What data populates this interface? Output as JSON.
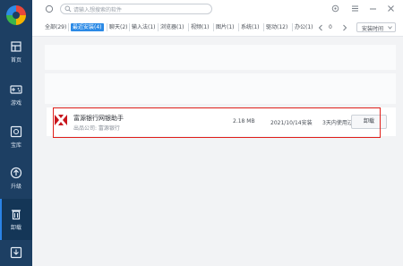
{
  "colors": {
    "sidebar_bg": "#1d3f63",
    "accent": "#2b8ae6",
    "highlight_border": "#e0201b"
  },
  "sidebar": {
    "items": [
      {
        "label": "首页",
        "icon": "home-icon"
      },
      {
        "label": "游戏",
        "icon": "gamepad-icon"
      },
      {
        "label": "宝库",
        "icon": "treasury-icon"
      },
      {
        "label": "升级",
        "icon": "upgrade-icon"
      },
      {
        "label": "卸载",
        "icon": "trash-icon",
        "active": true
      }
    ]
  },
  "search": {
    "placeholder": "请输入想搜索的软件"
  },
  "tabs": [
    {
      "label": "全部(29)"
    },
    {
      "label": "最近安装(4)",
      "active": true
    },
    {
      "label": "聊天(2)"
    },
    {
      "label": "输入法(1)"
    },
    {
      "label": "浏览器(1)"
    },
    {
      "label": "视频(1)"
    },
    {
      "label": "图片(1)"
    },
    {
      "label": "系统(1)"
    },
    {
      "label": "驱动(12)"
    },
    {
      "label": "办公(1)"
    },
    {
      "label": "0"
    }
  ],
  "sort": {
    "label": "安装时间"
  },
  "app": {
    "name": "富源银行网银助手",
    "publisher": "出品公司: 富源银行",
    "size": "2.18 MB",
    "install_date": "2021/10/14安装",
    "last_used": "3天内使用过",
    "uninstall_label": "卸载"
  }
}
